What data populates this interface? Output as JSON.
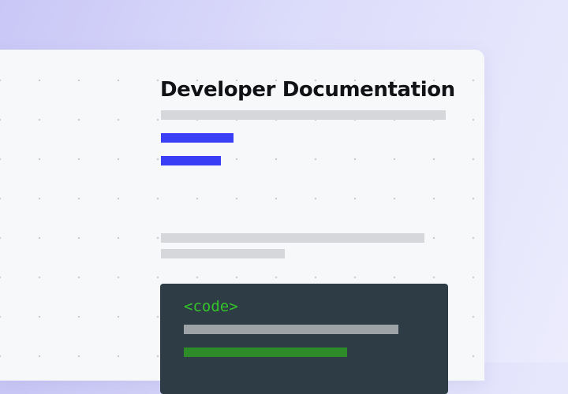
{
  "page": {
    "title": "Developer Documentation"
  },
  "code_block": {
    "tag": "<code>"
  },
  "colors": {
    "background_from": "#c9c7f6",
    "background_to": "#ececfd",
    "card": "#f7f8fa",
    "accent_blue": "#3a3ff5",
    "placeholder_gray": "#d6d7da",
    "code_background": "#2d3c45",
    "code_text": "#35c22a",
    "code_line_gray": "#9ea3a8",
    "code_line_green": "#2e8b2a"
  }
}
